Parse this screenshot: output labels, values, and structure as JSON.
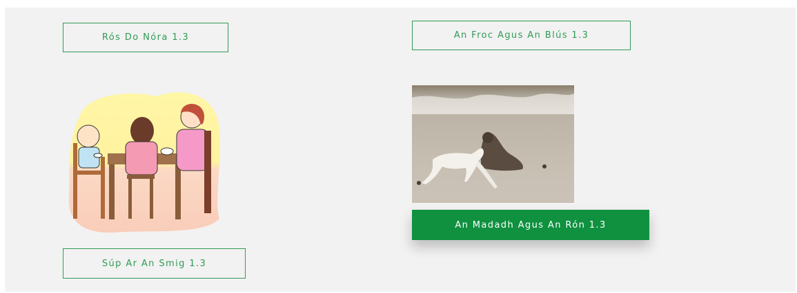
{
  "cards": {
    "ros_do_nora": {
      "label": "Rós Do Nóra 1.3"
    },
    "froc_agus_blus": {
      "label": "An Froc Agus An Blús 1.3"
    },
    "madadh_agus_ron": {
      "label": "An Madadh Agus An Rón 1.3"
    },
    "sup_ar_an_smig": {
      "label": "Súp Ar An Smig 1.3"
    }
  },
  "colors": {
    "accent": "#2f9a55",
    "accent_filled": "#0f9140",
    "panel_bg": "#f2f2f2"
  },
  "images": {
    "family_meal": "family-at-table-illustration",
    "dog_and_seal": "dog-and-seal-on-beach-photo"
  }
}
